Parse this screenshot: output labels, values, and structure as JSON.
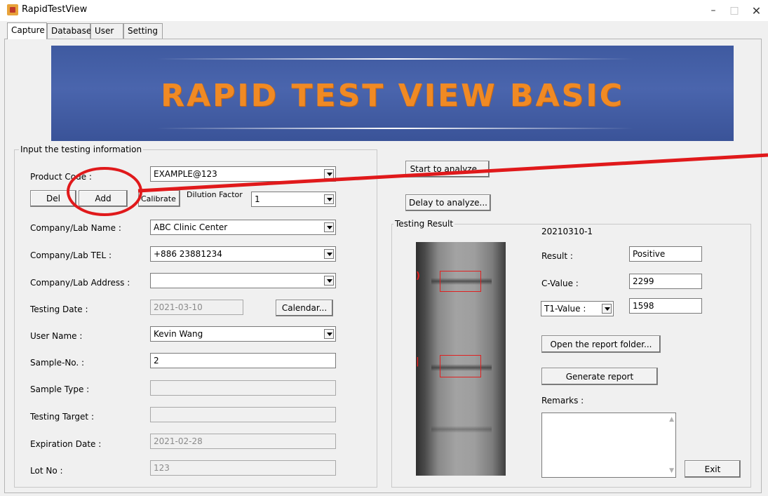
{
  "window": {
    "title": "RapidTestView",
    "controls": {
      "minimize": "–",
      "maximize": "□",
      "close": "✕"
    }
  },
  "tabs": [
    {
      "label": "Capture",
      "active": true
    },
    {
      "label": "Database"
    },
    {
      "label": "User"
    },
    {
      "label": "Setting"
    }
  ],
  "banner": {
    "text": "RAPID TEST VIEW BASIC"
  },
  "input_group": {
    "title": "Input the testing information",
    "product_code": {
      "label": "Product Code :",
      "value": "EXAMPLE@123"
    },
    "buttons": {
      "del": "Del",
      "add": "Add",
      "calibrate": "Calibrate"
    },
    "dilution_factor": {
      "label": "Dilution Factor",
      "value": "1"
    },
    "company_name": {
      "label": "Company/Lab Name :",
      "value": "ABC Clinic Center"
    },
    "company_tel": {
      "label": "Company/Lab TEL :",
      "value": "+886 23881234"
    },
    "company_address": {
      "label": "Company/Lab Address :",
      "value": ""
    },
    "testing_date": {
      "label": "Testing Date :",
      "value": "2021-03-10",
      "button": "Calendar..."
    },
    "user_name": {
      "label": "User Name :",
      "value": "Kevin Wang"
    },
    "sample_no": {
      "label": "Sample-No. :",
      "value": "2"
    },
    "sample_type": {
      "label": "Sample Type :",
      "value": ""
    },
    "testing_target": {
      "label": "Testing Target :",
      "value": ""
    },
    "expiration_date": {
      "label": "Expiration Date :",
      "value": "2021-02-28"
    },
    "lot_no": {
      "label": "Lot No :",
      "value": "123"
    }
  },
  "actions": {
    "start": "Start to analyze...",
    "delay": "Delay to analyze..."
  },
  "result_group": {
    "title": "Testing Result",
    "sample_id": "20210310-1",
    "result": {
      "label": "Result :",
      "value": "Positive"
    },
    "c_value": {
      "label": "C-Value :",
      "value": "2299"
    },
    "t1_value": {
      "select": "T1-Value :",
      "value": "1598"
    },
    "open_folder": "Open the report folder...",
    "generate": "Generate report",
    "remarks": {
      "label": "Remarks :",
      "value": ""
    },
    "exit": "Exit"
  },
  "colors": {
    "banner_bg": "#4a65ad",
    "banner_text": "#f08a24",
    "annotation": "#e0191b",
    "roi": "#e02020"
  },
  "icons": [
    "app-icon",
    "minimize-icon",
    "maximize-icon",
    "close-icon",
    "chevron-down-icon"
  ]
}
